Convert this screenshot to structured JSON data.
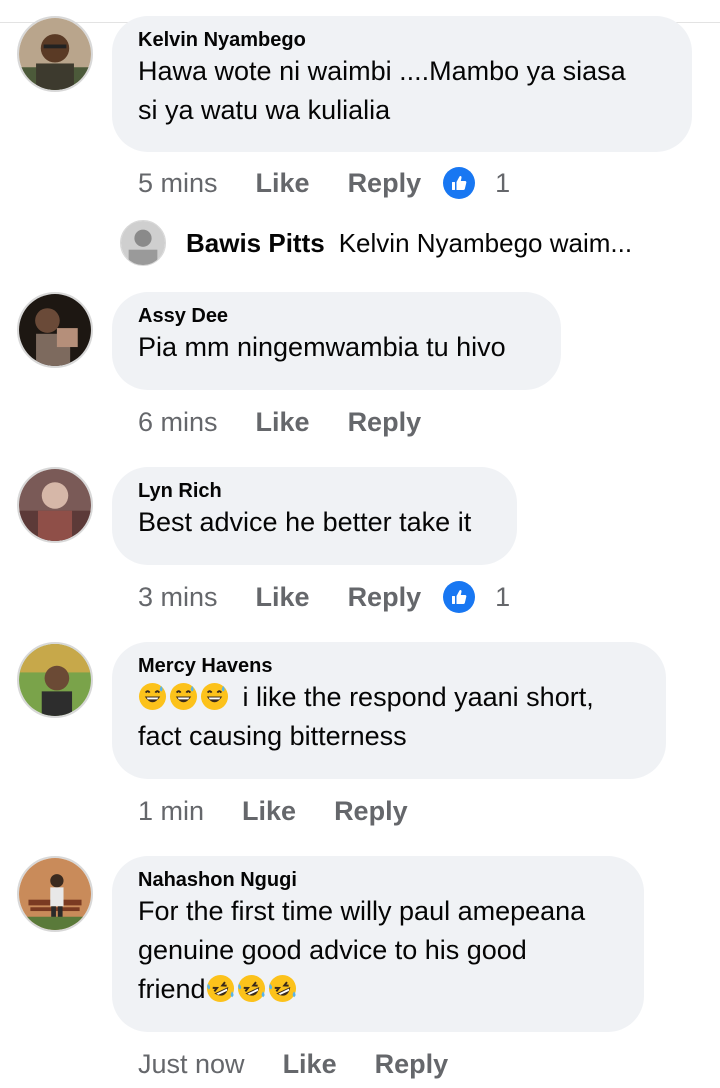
{
  "comments": [
    {
      "author": "Kelvin Nyambego",
      "lines": [
        "Hawa wote ni waimbi ....Mambo ya siasa",
        "si ya watu wa kulialia"
      ],
      "time": "5 mins",
      "like_label": "Like",
      "reply_label": "Reply",
      "reactions": "1",
      "avatar_icon": "profile-photo"
    },
    {
      "author": "Assy Dee",
      "lines": [
        "Pia mm ningemwambia tu hivo"
      ],
      "time": "6 mins",
      "like_label": "Like",
      "reply_label": "Reply",
      "avatar_icon": "profile-photo"
    },
    {
      "author": "Lyn Rich",
      "lines": [
        "Best advice he better take it"
      ],
      "time": "3 mins",
      "like_label": "Like",
      "reply_label": "Reply",
      "reactions": "1",
      "avatar_icon": "profile-photo"
    },
    {
      "author": "Mercy Havens",
      "lines": [
        "i like the respond yaani  short,",
        "fact causing bitterness"
      ],
      "time": "1 min",
      "like_label": "Like",
      "reply_label": "Reply",
      "emoji_prefix": [
        "grinning-sweat-emoji",
        "grinning-sweat-emoji",
        "grinning-sweat-emoji"
      ],
      "avatar_icon": "profile-photo"
    },
    {
      "author": "Nahashon Ngugi",
      "lines": [
        "For the first time willy paul amepeana",
        "genuine good advice to his good",
        "friend"
      ],
      "time": "Just now",
      "like_label": "Like",
      "reply_label": "Reply",
      "emoji_suffix": [
        "rolling-laughing-emoji",
        "rolling-laughing-emoji",
        "rolling-laughing-emoji"
      ],
      "avatar_icon": "profile-photo"
    }
  ],
  "reply_preview": {
    "author": "Bawis Pitts",
    "text": "Kelvin Nyambego waim...",
    "avatar_icon": "profile-photo"
  },
  "colors": {
    "bubble": "#f0f2f5",
    "secondary_text": "#65676b",
    "primary_text": "#050505",
    "like_blue": "#1877f2"
  },
  "icons": {
    "reaction": "thumbs-up-icon"
  }
}
